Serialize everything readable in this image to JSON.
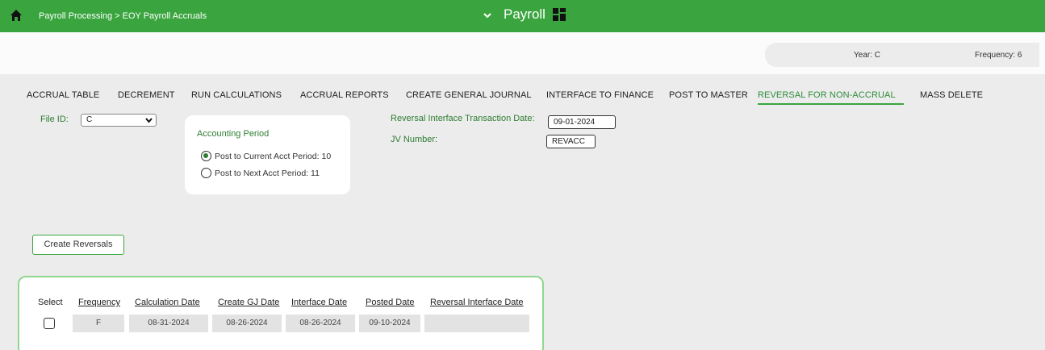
{
  "header": {
    "breadcrumb": "Payroll Processing > EOY Payroll Accruals",
    "app_title": "Payroll",
    "brand_color": "#3aa53f"
  },
  "info": {
    "year_label": "Year:",
    "year_value": "C",
    "frequency_label": "Frequency:",
    "frequency_value": "6"
  },
  "tabs": [
    {
      "label": "ACCRUAL TABLE"
    },
    {
      "label": "DECREMENT"
    },
    {
      "label": "RUN CALCULATIONS"
    },
    {
      "label": "ACCRUAL REPORTS"
    },
    {
      "label": "CREATE GENERAL JOURNAL"
    },
    {
      "label": "INTERFACE TO FINANCE"
    },
    {
      "label": "POST TO MASTER"
    },
    {
      "label": "REVERSAL FOR NON-ACCRUAL",
      "active": true
    },
    {
      "label": "MASS DELETE"
    }
  ],
  "form": {
    "file_id_label": "File ID:",
    "file_id_value": "C",
    "accounting_period_title": "Accounting Period",
    "radio_current": "Post to Current Acct Period: 10",
    "radio_next": "Post to Next Acct Period: 11",
    "reversal_date_label": "Reversal Interface Transaction Date:",
    "reversal_date_value": "09-01-2024",
    "jv_label": "JV Number:",
    "jv_value": "REVACC"
  },
  "actions": {
    "create_reversals": "Create Reversals"
  },
  "table": {
    "headers": [
      "Select",
      "Frequency",
      "Calculation Date",
      "Create GJ Date",
      "Interface Date",
      "Posted Date",
      "Reversal Interface Date"
    ],
    "rows": [
      {
        "frequency": "F",
        "calculation_date": "08-31-2024",
        "create_gj_date": "08-26-2024",
        "interface_date": "08-26-2024",
        "posted_date": "09-10-2024",
        "reversal_interface_date": ""
      }
    ]
  }
}
